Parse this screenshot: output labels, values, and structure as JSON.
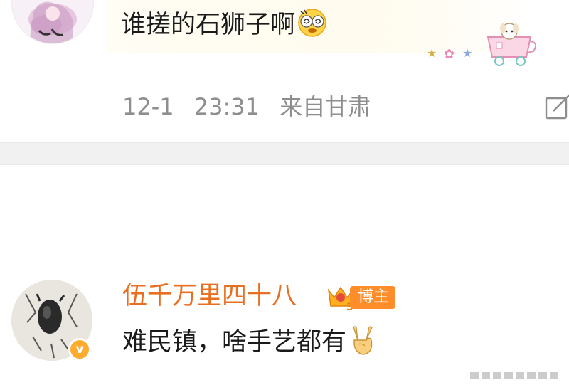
{
  "comments": [
    {
      "text": "谁搓的石狮子啊",
      "emoji": "dizzy-face-emoji",
      "sticker": "tea-cup-dog-sticker",
      "date": "12-1",
      "time": "23:31",
      "location": "来自甘肃",
      "edit_icon": "edit-icon"
    },
    {
      "username": "伍千万里四十八",
      "badge_level": "3",
      "badge_label": "博主",
      "verified_mark": "v",
      "text": "难民镇，啥手艺都有",
      "emoji": "victory-hand-emoji"
    }
  ],
  "colors": {
    "username": "#e86f21",
    "badge": "#ff8d2a",
    "meta": "#8e8e8e",
    "divider": "#f1f1f1",
    "verified": "#ffab2e"
  }
}
